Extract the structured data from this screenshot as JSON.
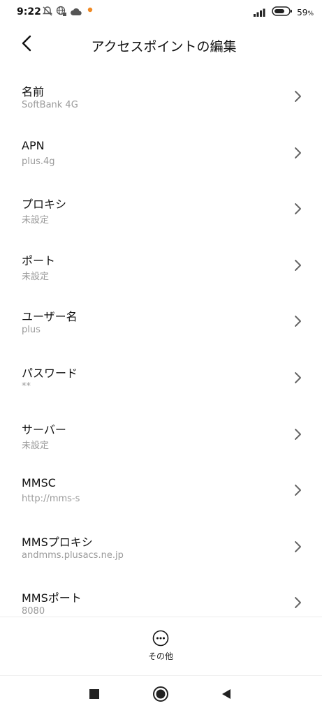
{
  "status_bar": {
    "time": "9:22",
    "battery_percent": "59",
    "battery_unit": "%",
    "icons": [
      "mute-icon",
      "vpn-globe-icon",
      "cloud-icon",
      "notification-dot-icon",
      "signal-icon",
      "battery-icon"
    ],
    "accent_dot_color": "#f08a24"
  },
  "header": {
    "back_icon": "back-arrow-icon",
    "title": "アクセスポイントの編集"
  },
  "settings": [
    {
      "label": "名前",
      "value": "SoftBank 4G"
    },
    {
      "label": "APN",
      "value": "plus.4g"
    },
    {
      "label": "プロキシ",
      "value": "未設定"
    },
    {
      "label": "ポート",
      "value": "未設定"
    },
    {
      "label": "ユーザー名",
      "value": "plus"
    },
    {
      "label": "パスワード",
      "value": "**"
    },
    {
      "label": "サーバー",
      "value": "未設定"
    },
    {
      "label": "MMSC",
      "value": "http://mms-s"
    },
    {
      "label": "MMSプロキシ",
      "value": "andmms.plusacs.ne.jp"
    },
    {
      "label": "MMSポート",
      "value": "8080"
    }
  ],
  "footer": {
    "more_label": "その他",
    "more_icon": "more-options-icon"
  },
  "nav_bar": {
    "icons": [
      "recents-square-icon",
      "home-circle-icon",
      "back-triangle-icon"
    ]
  }
}
